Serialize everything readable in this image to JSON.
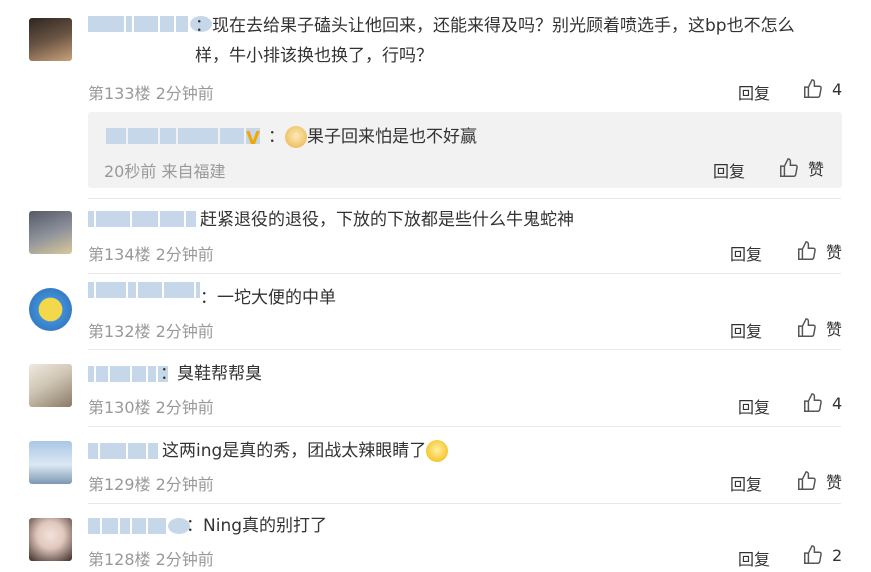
{
  "reply_label": "回复",
  "like_label": "赞",
  "comments": [
    {
      "text": "：现在去给果子磕头让他回来，还能来得及吗？别光顾着喷选手，这bp也不怎么样，牛小排该换也换了，行吗？",
      "meta": "第133楼  2分钟前",
      "likes": "4",
      "avatar_colors": [
        "#5a4a3a",
        "#c9a27a"
      ],
      "sub": {
        "text": "果子回来怕是也不好赢",
        "meta": "20秒前  来自福建",
        "likes": "赞"
      }
    },
    {
      "text": "赶紧退役的退役，下放的下放都是些什么牛鬼蛇神",
      "meta": "第134楼  2分钟前",
      "likes": "赞",
      "avatar_colors": [
        "#6b6f7a",
        "#d9c89a"
      ]
    },
    {
      "text": "：一坨大便的中单",
      "meta": "第132楼  2分钟前",
      "likes": "赞",
      "avatar_colors": [
        "#3f8ed8",
        "#f2d84a"
      ]
    },
    {
      "text": "：臭鞋帮帮臭",
      "meta": "第130楼  2分钟前",
      "likes": "4",
      "avatar_colors": [
        "#d8d2c6",
        "#8a7a66"
      ]
    },
    {
      "text": "这两ing是真的秀，团战太辣眼睛了",
      "meta": "第129楼  2分钟前",
      "likes": "赞",
      "avatar_colors": [
        "#a9c7e6",
        "#e6eef6"
      ]
    },
    {
      "text": "：Ning真的别打了",
      "meta": "第128楼  2分钟前",
      "likes": "2",
      "avatar_colors": [
        "#e9d6cf",
        "#3a2a24"
      ]
    }
  ]
}
